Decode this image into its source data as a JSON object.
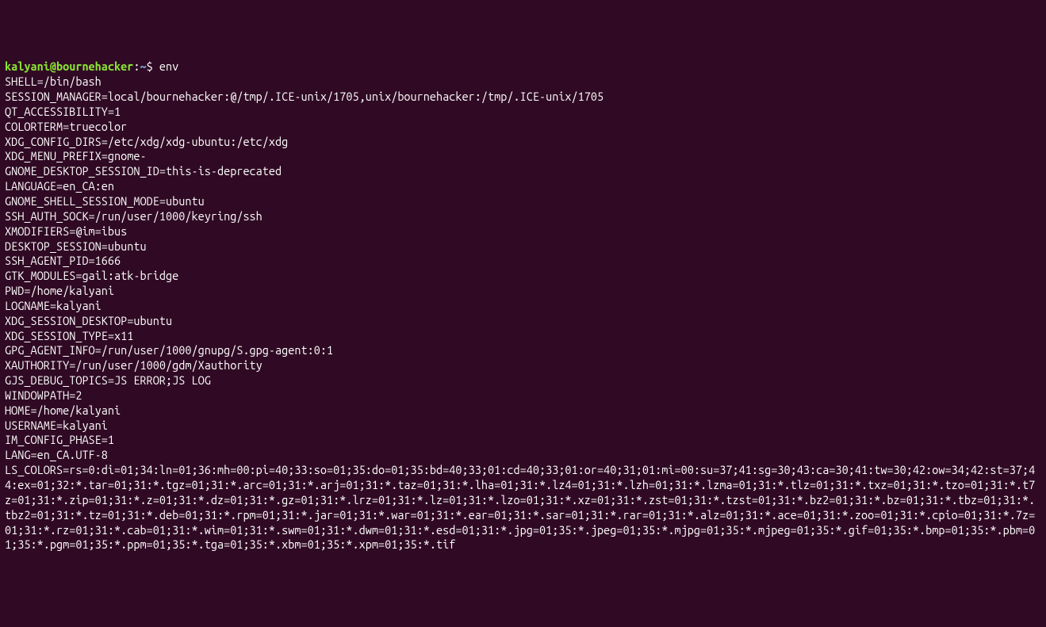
{
  "prompt": {
    "userHost": "kalyani@bournehacker",
    "separator": ":",
    "path": "~",
    "symbol": "$"
  },
  "command": "env",
  "output": "SHELL=/bin/bash\nSESSION_MANAGER=local/bournehacker:@/tmp/.ICE-unix/1705,unix/bournehacker:/tmp/.ICE-unix/1705\nQT_ACCESSIBILITY=1\nCOLORTERM=truecolor\nXDG_CONFIG_DIRS=/etc/xdg/xdg-ubuntu:/etc/xdg\nXDG_MENU_PREFIX=gnome-\nGNOME_DESKTOP_SESSION_ID=this-is-deprecated\nLANGUAGE=en_CA:en\nGNOME_SHELL_SESSION_MODE=ubuntu\nSSH_AUTH_SOCK=/run/user/1000/keyring/ssh\nXMODIFIERS=@im=ibus\nDESKTOP_SESSION=ubuntu\nSSH_AGENT_PID=1666\nGTK_MODULES=gail:atk-bridge\nPWD=/home/kalyani\nLOGNAME=kalyani\nXDG_SESSION_DESKTOP=ubuntu\nXDG_SESSION_TYPE=x11\nGPG_AGENT_INFO=/run/user/1000/gnupg/S.gpg-agent:0:1\nXAUTHORITY=/run/user/1000/gdm/Xauthority\nGJS_DEBUG_TOPICS=JS ERROR;JS LOG\nWINDOWPATH=2\nHOME=/home/kalyani\nUSERNAME=kalyani\nIM_CONFIG_PHASE=1\nLANG=en_CA.UTF-8\nLS_COLORS=rs=0:di=01;34:ln=01;36:mh=00:pi=40;33:so=01;35:do=01;35:bd=40;33;01:cd=40;33;01:or=40;31;01:mi=00:su=37;41:sg=30;43:ca=30;41:tw=30;42:ow=34;42:st=37;44:ex=01;32:*.tar=01;31:*.tgz=01;31:*.arc=01;31:*.arj=01;31:*.taz=01;31:*.lha=01;31:*.lz4=01;31:*.lzh=01;31:*.lzma=01;31:*.tlz=01;31:*.txz=01;31:*.tzo=01;31:*.t7z=01;31:*.zip=01;31:*.z=01;31:*.dz=01;31:*.gz=01;31:*.lrz=01;31:*.lz=01;31:*.lzo=01;31:*.xz=01;31:*.zst=01;31:*.tzst=01;31:*.bz2=01;31:*.bz=01;31:*.tbz=01;31:*.tbz2=01;31:*.tz=01;31:*.deb=01;31:*.rpm=01;31:*.jar=01;31:*.war=01;31:*.ear=01;31:*.sar=01;31:*.rar=01;31:*.alz=01;31:*.ace=01;31:*.zoo=01;31:*.cpio=01;31:*.7z=01;31:*.rz=01;31:*.cab=01;31:*.wim=01;31:*.swm=01;31:*.dwm=01;31:*.esd=01;31:*.jpg=01;35:*.jpeg=01;35:*.mjpg=01;35:*.mjpeg=01;35:*.gif=01;35:*.bmp=01;35:*.pbm=01;35:*.pgm=01;35:*.ppm=01;35:*.tga=01;35:*.xbm=01;35:*.xpm=01;35:*.tif"
}
